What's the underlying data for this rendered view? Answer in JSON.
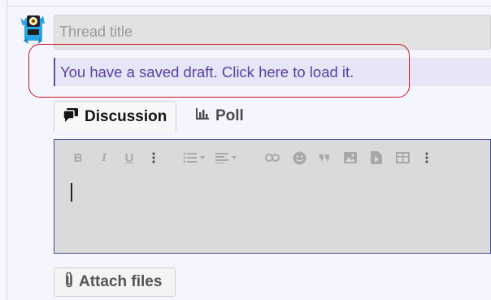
{
  "thread": {
    "title_placeholder": "Thread title",
    "title_value": ""
  },
  "draft_notice": {
    "text": "You have a saved draft. Click here to load it."
  },
  "tabs": [
    {
      "label": "Discussion",
      "icon": "discussion-icon",
      "active": true
    },
    {
      "label": "Poll",
      "icon": "poll-chart-icon",
      "active": false
    }
  ],
  "toolbar": {
    "items": [
      "bold",
      "italic",
      "underline",
      "more-text-options",
      "list",
      "align",
      "link",
      "smilie",
      "quote",
      "image",
      "media",
      "table",
      "more-options"
    ],
    "bold_glyph": "B",
    "italic_glyph": "I",
    "underline_glyph": "U"
  },
  "attach": {
    "label": "Attach files",
    "icon": "paperclip-icon"
  },
  "colors": {
    "background": "#f5f5fd",
    "notice_text": "#5b3ea5",
    "notice_bg": "#e6e6f6",
    "annotation": "#c8141e",
    "editor_border": "#4c4c9a"
  }
}
